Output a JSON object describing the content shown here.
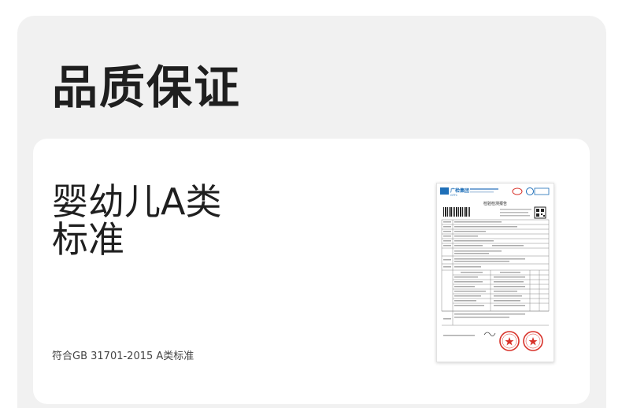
{
  "section": {
    "title": "品质保证"
  },
  "card": {
    "heading": "婴幼儿A类标准",
    "note": "符合GB 31701-2015 A类标准"
  },
  "report": {
    "brand": "广检集团",
    "brand_sub": "GTTC",
    "doc_title": "检验检测报告",
    "accent_color": "#1f6fb8",
    "stamp_color": "#d8322a"
  }
}
